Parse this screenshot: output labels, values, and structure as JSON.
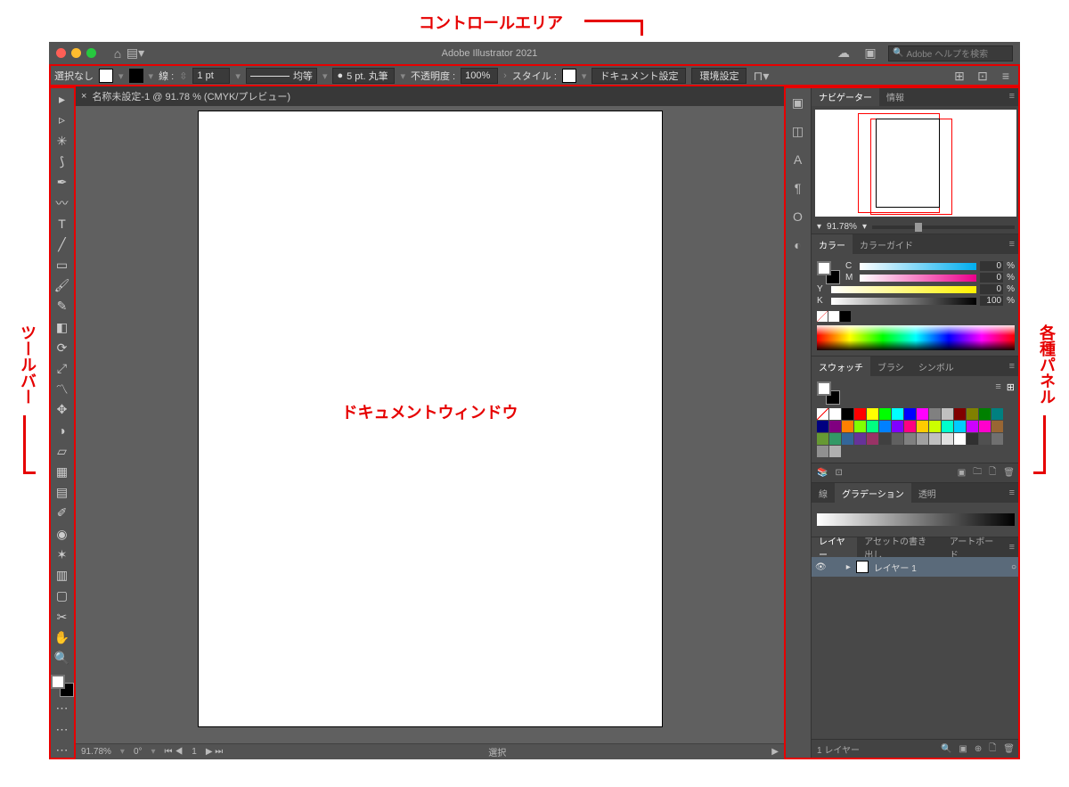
{
  "annotations": {
    "control_area": "コントロールエリア",
    "toolbar": "ツールバー",
    "panels": "各種パネル",
    "document_window": "ドキュメントウィンドウ"
  },
  "titlebar": {
    "app_title": "Adobe Illustrator 2021",
    "search_placeholder": "Adobe ヘルプを検索"
  },
  "control": {
    "selection": "選択なし",
    "stroke_label": "線 :",
    "stroke_weight": "1 pt",
    "stroke_profile": "均等",
    "brush": "5 pt. 丸筆",
    "opacity_label": "不透明度 :",
    "opacity_value": "100%",
    "style_label": "スタイル :",
    "doc_setup": "ドキュメント設定",
    "prefs": "環境設定"
  },
  "document": {
    "tab_title": "名称未設定-1 @ 91.78 % (CMYK/プレビュー)",
    "status_zoom": "91.78%",
    "status_rotation": "0°",
    "status_page": "1",
    "status_mode": "選択"
  },
  "tools": [
    {
      "name": "selection-tool",
      "glyph": "▸"
    },
    {
      "name": "direct-selection-tool",
      "glyph": "▹"
    },
    {
      "name": "magic-wand-tool",
      "glyph": "✳"
    },
    {
      "name": "lasso-tool",
      "glyph": "⟆"
    },
    {
      "name": "pen-tool",
      "glyph": "✒"
    },
    {
      "name": "curvature-tool",
      "glyph": "〰"
    },
    {
      "name": "type-tool",
      "glyph": "T"
    },
    {
      "name": "line-tool",
      "glyph": "╱"
    },
    {
      "name": "rectangle-tool",
      "glyph": "▭"
    },
    {
      "name": "paintbrush-tool",
      "glyph": "🖌"
    },
    {
      "name": "shaper-tool",
      "glyph": "✎"
    },
    {
      "name": "eraser-tool",
      "glyph": "◧"
    },
    {
      "name": "rotate-tool",
      "glyph": "⟳"
    },
    {
      "name": "scale-tool",
      "glyph": "⤢"
    },
    {
      "name": "width-tool",
      "glyph": "〽"
    },
    {
      "name": "free-transform-tool",
      "glyph": "✥"
    },
    {
      "name": "shape-builder-tool",
      "glyph": "◑"
    },
    {
      "name": "perspective-tool",
      "glyph": "▱"
    },
    {
      "name": "mesh-tool",
      "glyph": "▦"
    },
    {
      "name": "gradient-tool",
      "glyph": "▤"
    },
    {
      "name": "eyedropper-tool",
      "glyph": "✐"
    },
    {
      "name": "blend-tool",
      "glyph": "◉"
    },
    {
      "name": "symbol-sprayer-tool",
      "glyph": "✶"
    },
    {
      "name": "column-graph-tool",
      "glyph": "▥"
    },
    {
      "name": "artboard-tool",
      "glyph": "▢"
    },
    {
      "name": "slice-tool",
      "glyph": "✂"
    },
    {
      "name": "hand-tool",
      "glyph": "✋"
    },
    {
      "name": "zoom-tool",
      "glyph": "🔍"
    }
  ],
  "dock_icons": [
    "properties-icon",
    "libraries-icon",
    "character-icon",
    "paragraph-icon",
    "opentype-icon",
    "appearance-icon"
  ],
  "panels": {
    "navigator": {
      "tabs": [
        "ナビゲーター",
        "情報"
      ],
      "zoom": "91.78%"
    },
    "color": {
      "tabs": [
        "カラー",
        "カラーガイド"
      ],
      "channels": [
        {
          "label": "C",
          "value": "0",
          "unit": "%",
          "bar": "linear-gradient(to right,#fff,#00aeef)"
        },
        {
          "label": "M",
          "value": "0",
          "unit": "%",
          "bar": "linear-gradient(to right,#fff,#ec008c)"
        },
        {
          "label": "Y",
          "value": "0",
          "unit": "%",
          "bar": "linear-gradient(to right,#fff,#fff200)"
        },
        {
          "label": "K",
          "value": "100",
          "unit": "%",
          "bar": "linear-gradient(to right,#fff,#000)"
        }
      ]
    },
    "swatches": {
      "tabs": [
        "スウォッチ",
        "ブラシ",
        "シンボル"
      ],
      "colors": [
        "#ffffff",
        "#000000",
        "#ff0000",
        "#ffff00",
        "#00ff00",
        "#00ffff",
        "#0000ff",
        "#ff00ff",
        "#808080",
        "#c0c0c0",
        "#800000",
        "#808000",
        "#008000",
        "#008080",
        "#000080",
        "#800080",
        "#ff8000",
        "#80ff00",
        "#00ff80",
        "#0080ff",
        "#8000ff",
        "#ff0080",
        "#ffcc00",
        "#ccff00",
        "#00ffcc",
        "#00ccff",
        "#cc00ff",
        "#ff00cc",
        "#996633",
        "#669933",
        "#339966",
        "#336699",
        "#663399",
        "#993366",
        "#404040",
        "#606060",
        "#808080",
        "#a0a0a0",
        "#c0c0c0",
        "#e0e0e0",
        "#ffffff",
        "#303030",
        "#505050",
        "#707070",
        "#909090",
        "#b0b0b0"
      ]
    },
    "gradient": {
      "tabs": [
        "線",
        "グラデーション",
        "透明"
      ]
    },
    "layers": {
      "tabs": [
        "レイヤー",
        "アセットの書き出し",
        "アートボード"
      ],
      "layer_name": "レイヤー 1",
      "footer": "1 レイヤー"
    }
  }
}
